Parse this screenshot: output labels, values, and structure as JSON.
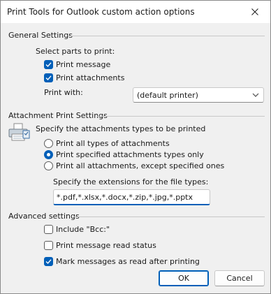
{
  "window": {
    "title": "Print Tools for Outlook custom action options",
    "close_glyph": "✕"
  },
  "general": {
    "heading": "General Settings",
    "select_parts_label": "Select parts to print:",
    "print_message": {
      "label": "Print message",
      "checked": true
    },
    "print_attachments": {
      "label": "Print attachments",
      "checked": true
    },
    "print_with_label": "Print with:",
    "printer_select": {
      "value": "(default printer)"
    }
  },
  "attachment": {
    "heading": "Attachment Print Settings",
    "specify_label": "Specify the attachments types to be printed",
    "options": [
      {
        "label": "Print all types of attachments",
        "selected": false
      },
      {
        "label": "Print specified attachments types only",
        "selected": true
      },
      {
        "label": "Print all attachments, except specified ones",
        "selected": false
      }
    ],
    "extensions_label": "Specify the extensions for the file types:",
    "extensions_value": "*.pdf,*.xlsx,*.docx,*.zip,*.jpg,*.pptx"
  },
  "advanced": {
    "heading": "Advanced settings",
    "include_bcc": {
      "label": "Include \"Bcc:\"",
      "checked": false
    },
    "print_read_status": {
      "label": "Print message read status",
      "checked": false
    },
    "mark_as_read": {
      "label": "Mark messages as read after printing",
      "checked": true
    }
  },
  "buttons": {
    "ok": "OK",
    "cancel": "Cancel"
  },
  "colors": {
    "accent": "#005fb8",
    "background": "#f0f0f0"
  }
}
